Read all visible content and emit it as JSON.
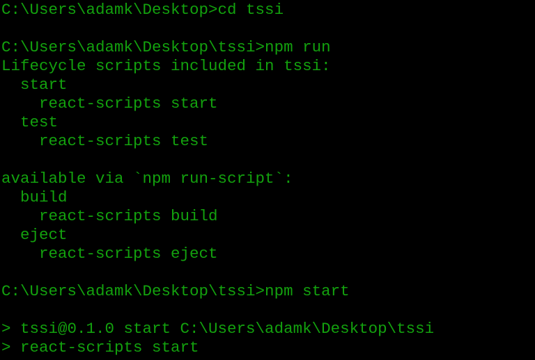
{
  "theme": {
    "background": "#000000",
    "foreground": "#13a10e"
  },
  "terminal": {
    "lines": [
      "C:\\Users\\adamk\\Desktop>cd tssi",
      "",
      "C:\\Users\\adamk\\Desktop\\tssi>npm run",
      "Lifecycle scripts included in tssi:",
      "  start",
      "    react-scripts start",
      "  test",
      "    react-scripts test",
      "",
      "available via `npm run-script`:",
      "  build",
      "    react-scripts build",
      "  eject",
      "    react-scripts eject",
      "",
      "C:\\Users\\adamk\\Desktop\\tssi>npm start",
      "",
      "> tssi@0.1.0 start C:\\Users\\adamk\\Desktop\\tssi",
      "> react-scripts start"
    ]
  }
}
